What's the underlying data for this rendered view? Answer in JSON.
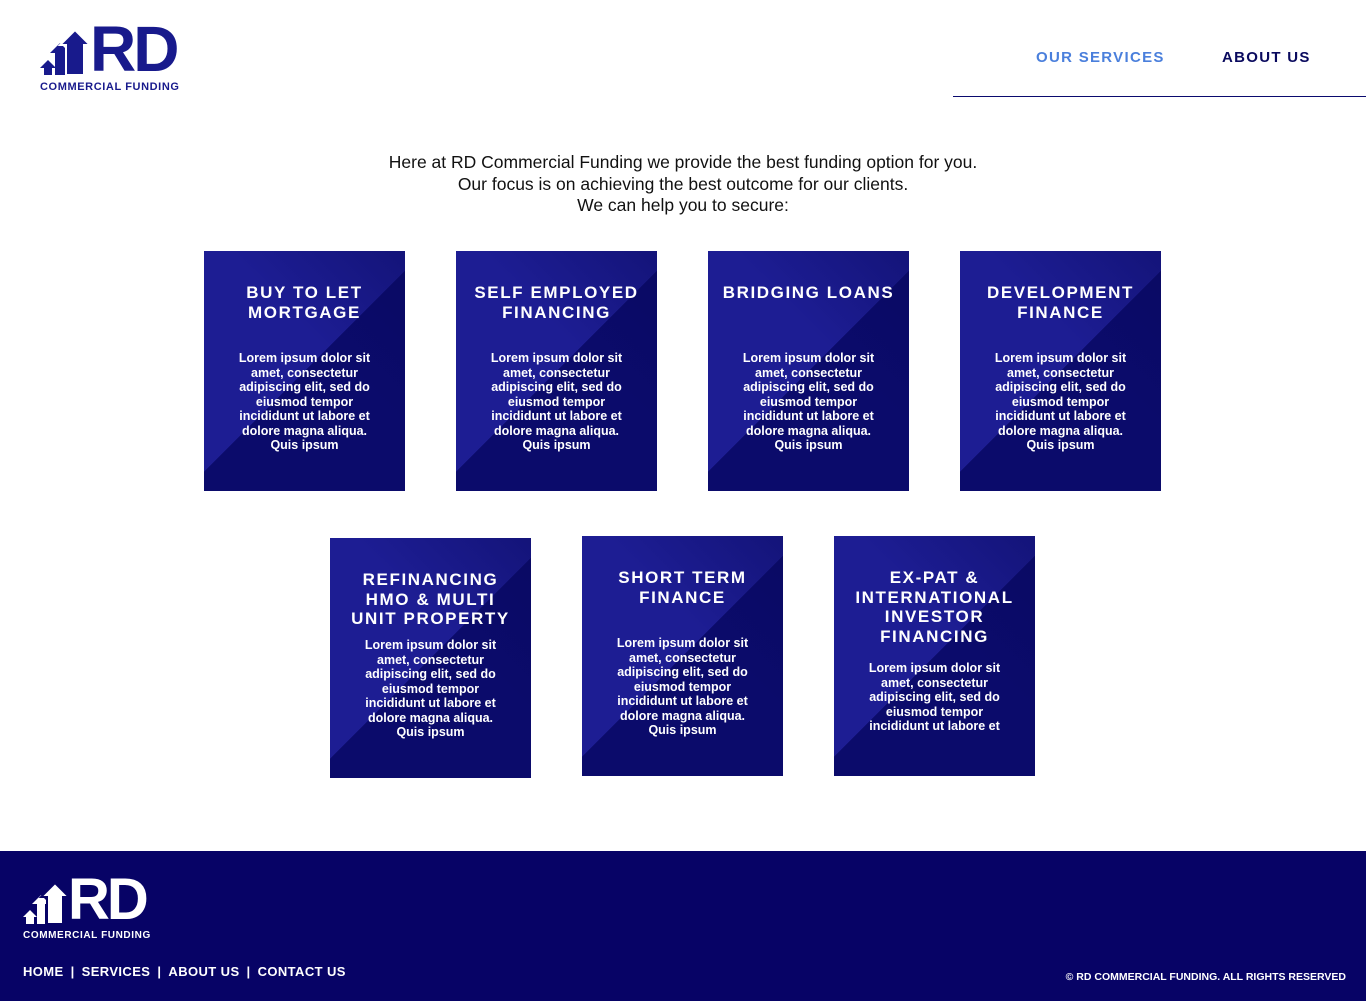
{
  "brand": {
    "logo_letters": "RD",
    "logo_tagline": "COMMERCIAL FUNDING",
    "primary_color": "#181a8c",
    "accent_color": "#4a7fdc",
    "footer_bg": "#070366"
  },
  "header": {
    "nav": [
      {
        "label": "OUR SERVICES",
        "active": true
      },
      {
        "label": "ABOUT US",
        "active": false
      }
    ]
  },
  "intro": {
    "lines": [
      "Here at RD Commercial Funding we provide the best funding option for you.",
      "Our focus is on achieving the best outcome for our clients.",
      "We can help you to secure:"
    ]
  },
  "services": [
    {
      "title": "BUY TO LET MORTGAGE",
      "text": "Lorem ipsum dolor sit amet, consectetur adipiscing elit, sed do eiusmod tempor incididunt ut labore et dolore magna aliqua. Quis ipsum"
    },
    {
      "title": "SELF EMPLOYED FINANCING",
      "text": "Lorem ipsum dolor sit amet, consectetur adipiscing elit, sed do eiusmod tempor incididunt ut labore et dolore magna aliqua. Quis ipsum"
    },
    {
      "title": "BRIDGING LOANS",
      "text": "Lorem ipsum dolor sit amet, consectetur adipiscing elit, sed do eiusmod tempor incididunt ut labore et dolore magna aliqua. Quis ipsum"
    },
    {
      "title": "DEVELOPMENT FINANCE",
      "text": "Lorem ipsum dolor sit amet, consectetur adipiscing elit, sed do eiusmod tempor incididunt ut labore et dolore magna aliqua. Quis ipsum"
    },
    {
      "title": "REFINANCING HMO & MULTI UNIT PROPERTY",
      "text": "Lorem ipsum dolor sit amet, consectetur adipiscing elit, sed do eiusmod tempor incididunt ut labore et dolore magna aliqua. Quis ipsum"
    },
    {
      "title": "SHORT TERM FINANCE",
      "text": "Lorem ipsum dolor sit amet, consectetur adipiscing elit, sed do eiusmod tempor incididunt ut labore et dolore magna aliqua. Quis ipsum"
    },
    {
      "title": "EX-PAT & INTERNATIONAL INVESTOR FINANCING",
      "text": "Lorem ipsum dolor sit amet, consectetur adipiscing elit, sed do eiusmod tempor incididunt ut labore et"
    }
  ],
  "footer": {
    "links": [
      "HOME",
      "SERVICES",
      "ABOUT US",
      "CONTACT US"
    ],
    "separator": "|",
    "copyright": "© RD COMMERCIAL FUNDING. ALL RIGHTS RESERVED"
  }
}
